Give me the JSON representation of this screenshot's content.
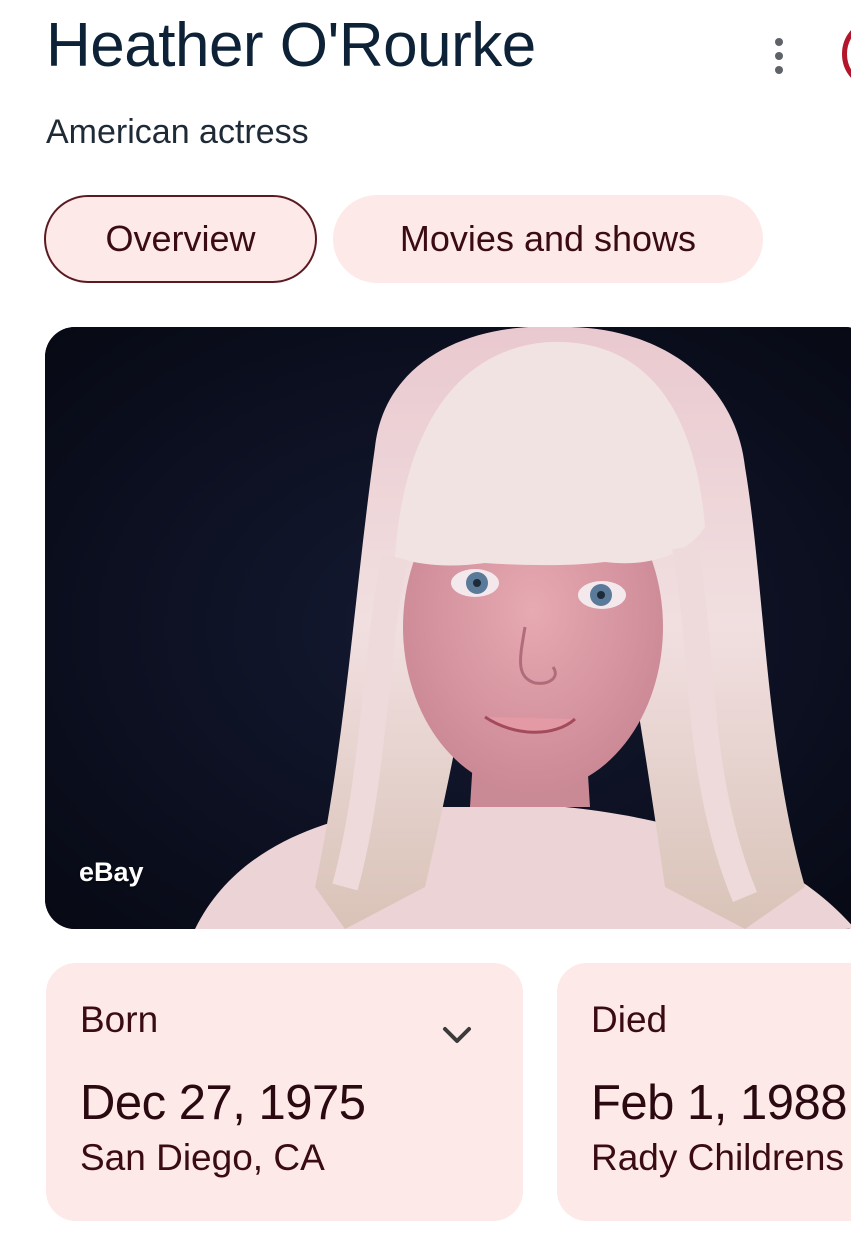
{
  "header": {
    "title": "Heather O'Rourke",
    "subtitle": "American actress",
    "more_icon": "more-vert-icon"
  },
  "tabs": [
    {
      "label": "Overview",
      "selected": true
    },
    {
      "label": "Movies and shows",
      "selected": false
    }
  ],
  "image": {
    "source": "eBay",
    "description_icon": "portrait-photo"
  },
  "facts": {
    "born": {
      "label": "Born",
      "date": "Dec 27, 1975",
      "place": "San Diego, CA",
      "expand_icon": "chevron-down-icon"
    },
    "died": {
      "label": "Died",
      "date": "Feb 1, 1988",
      "place": "Rady Childrens"
    }
  },
  "colors": {
    "accent": "#b3162b",
    "chip_bg": "#fde9e8",
    "chip_border": "#5b1a22",
    "title": "#0d2137"
  }
}
